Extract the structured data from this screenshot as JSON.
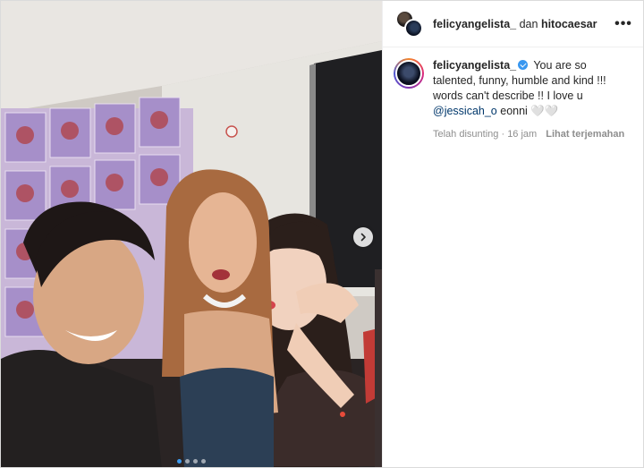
{
  "post": {
    "photo_alt": "Selfie of three people",
    "carousel": {
      "count": 4,
      "active": 0
    }
  },
  "header": {
    "username": "felicyangelista_",
    "joiner": "dan",
    "collab": "hitocaesar",
    "more_icon": "more-horizontal-icon"
  },
  "caption": {
    "username": "felicyangelista_",
    "verified": true,
    "text_before": " You are so talented, funny, humble and kind !!! words can't describe !! I love u ",
    "mention": "@jessicah_o",
    "text_after": " eonni 🤍🤍",
    "edited_label": "Telah disunting",
    "separator": "·",
    "time": "16 jam",
    "translate_label": "Lihat terjemahan"
  },
  "colors": {
    "link": "#00376b",
    "muted": "#8e8e8e",
    "dot_active": "#3d9bf0"
  }
}
